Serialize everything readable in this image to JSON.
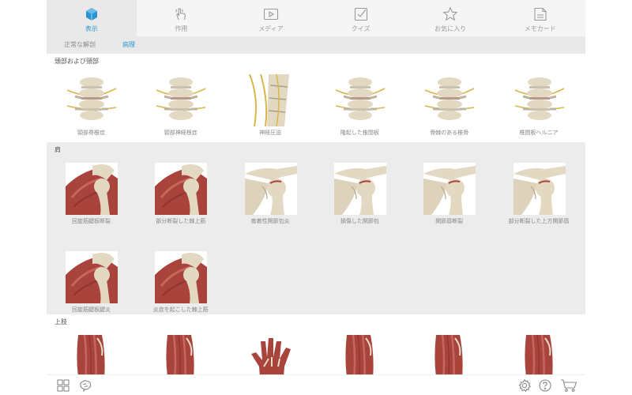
{
  "tabs": [
    {
      "label": "表示",
      "icon": "cube-icon",
      "active": true
    },
    {
      "label": "作用",
      "icon": "hand-gesture-icon",
      "active": false
    },
    {
      "label": "メディア",
      "icon": "play-icon",
      "active": false
    },
    {
      "label": "クイズ",
      "icon": "checkbox-icon",
      "active": false
    },
    {
      "label": "お気に入り",
      "icon": "star-icon",
      "active": false
    },
    {
      "label": "メモカード",
      "icon": "note-card-icon",
      "active": false
    }
  ],
  "subtabs": [
    {
      "label": "正常な解剖",
      "active": false
    },
    {
      "label": "病理",
      "active": true
    }
  ],
  "sections": [
    {
      "title": "頭部および頸部",
      "items": [
        {
          "label": "頸部脊椎症",
          "thumb": "spine"
        },
        {
          "label": "頸部神経根症",
          "thumb": "spine"
        },
        {
          "label": "神経圧迫",
          "thumb": "spine-side"
        },
        {
          "label": "隆起した椎間板",
          "thumb": "spine"
        },
        {
          "label": "骨棘のある椎骨",
          "thumb": "spine"
        },
        {
          "label": "椎間板ヘルニア",
          "thumb": "spine"
        }
      ]
    },
    {
      "title": "肩",
      "items": [
        {
          "label": "回旋筋腱板断裂",
          "thumb": "shoulder-muscle"
        },
        {
          "label": "部分断裂した棘上筋",
          "thumb": "shoulder-muscle"
        },
        {
          "label": "癒着性関節包炎",
          "thumb": "shoulder-bone"
        },
        {
          "label": "損傷した関節包",
          "thumb": "shoulder-bone"
        },
        {
          "label": "関節唇断裂",
          "thumb": "shoulder-bone"
        },
        {
          "label": "部分断裂した上方関節唇",
          "thumb": "shoulder-bone"
        },
        {
          "label": "回旋筋腱板腱炎",
          "thumb": "shoulder-muscle"
        },
        {
          "label": "炎症を起こした棘上筋",
          "thumb": "shoulder-muscle"
        }
      ]
    },
    {
      "title": "上肢",
      "items": [
        {
          "label": "",
          "thumb": "arm"
        },
        {
          "label": "",
          "thumb": "arm"
        },
        {
          "label": "",
          "thumb": "hand"
        },
        {
          "label": "",
          "thumb": "arm"
        },
        {
          "label": "",
          "thumb": "arm"
        },
        {
          "label": "",
          "thumb": "arm"
        }
      ]
    }
  ],
  "bottom": {
    "left": [
      "grid-view-icon",
      "brain-icon"
    ],
    "right": [
      "settings-icon",
      "help-icon",
      "cart-icon"
    ]
  },
  "colors": {
    "accent": "#2b95d4",
    "tabbar": "#f5f5f5",
    "section_alt": "#ececec",
    "text_muted": "#888888",
    "bone": "#e3d9c3",
    "muscle": "#a8443c",
    "nerve": "#d9b64a"
  }
}
